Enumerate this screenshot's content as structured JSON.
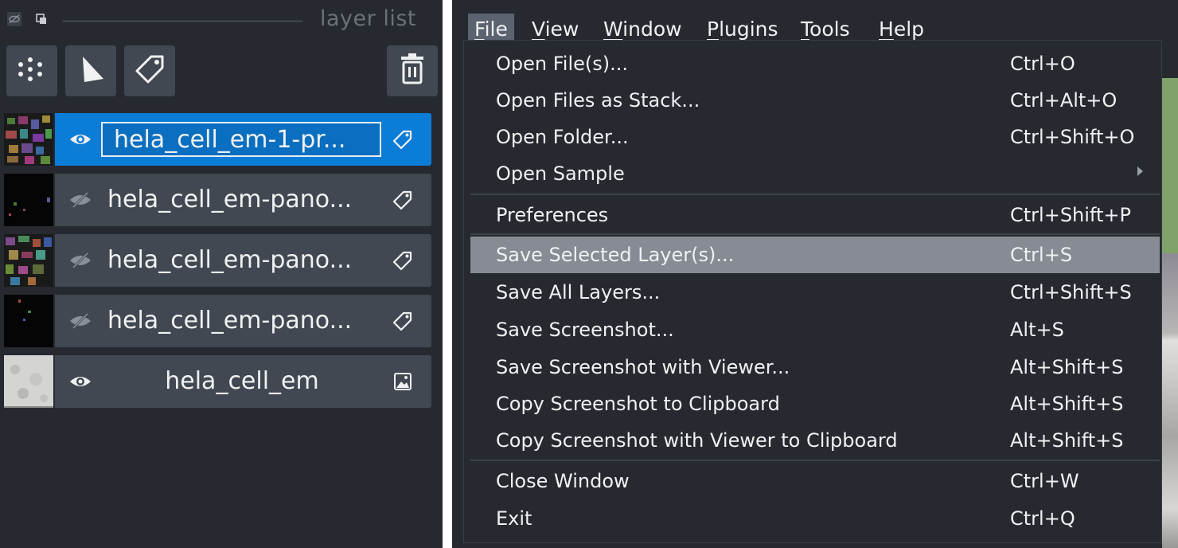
{
  "layer_panel": {
    "title": "layer list",
    "header_buttons": [
      "toggle-visibility-icon",
      "new-window-icon"
    ],
    "tools": [
      {
        "name": "new-points-layer",
        "icon": "points-icon"
      },
      {
        "name": "new-shapes-layer",
        "icon": "shapes-icon"
      },
      {
        "name": "new-labels-layer",
        "icon": "labels-tag-icon"
      },
      {
        "name": "delete-layer",
        "icon": "trash-icon"
      }
    ],
    "layers": [
      {
        "name": "hela_cell_em-1-pr...",
        "visible": true,
        "selected": true,
        "editing": true,
        "type": "labels"
      },
      {
        "name": "hela_cell_em-pano...",
        "visible": false,
        "selected": false,
        "editing": false,
        "type": "labels"
      },
      {
        "name": "hela_cell_em-pano...",
        "visible": false,
        "selected": false,
        "editing": false,
        "type": "labels"
      },
      {
        "name": "hela_cell_em-pano...",
        "visible": false,
        "selected": false,
        "editing": false,
        "type": "labels"
      },
      {
        "name": "hela_cell_em",
        "visible": true,
        "selected": false,
        "editing": false,
        "type": "image"
      }
    ]
  },
  "menubar": {
    "menus": [
      {
        "label": "File",
        "mnemonic": "F",
        "rest": "ile",
        "active": true
      },
      {
        "label": "View",
        "mnemonic": "V",
        "rest": "iew",
        "active": false
      },
      {
        "label": "Window",
        "mnemonic": "W",
        "rest": "indow",
        "active": false
      },
      {
        "label": "Plugins",
        "mnemonic": "P",
        "rest": "lugins",
        "active": false
      },
      {
        "label": "Tools",
        "mnemonic": "T",
        "rest": "ools",
        "active": false
      },
      {
        "label": "Help",
        "mnemonic": "H",
        "rest": "elp",
        "active": false
      }
    ]
  },
  "file_menu": {
    "groups": [
      [
        {
          "label": "Open File(s)...",
          "shortcut": "Ctrl+O"
        },
        {
          "label": "Open Files as Stack...",
          "shortcut": "Ctrl+Alt+O"
        },
        {
          "label": "Open Folder...",
          "shortcut": "Ctrl+Shift+O"
        },
        {
          "label": "Open Sample",
          "shortcut": "",
          "submenu": true
        }
      ],
      [
        {
          "label": "Preferences",
          "shortcut": "Ctrl+Shift+P"
        }
      ],
      [
        {
          "label": "Save Selected Layer(s)...",
          "shortcut": "Ctrl+S",
          "highlighted": true
        },
        {
          "label": "Save All Layers...",
          "shortcut": "Ctrl+Shift+S"
        },
        {
          "label": "Save Screenshot...",
          "shortcut": "Alt+S"
        },
        {
          "label": "Save Screenshot with Viewer...",
          "shortcut": "Alt+Shift+S"
        },
        {
          "label": "Copy Screenshot to Clipboard",
          "shortcut": "Alt+Shift+S"
        },
        {
          "label": "Copy Screenshot with Viewer to Clipboard",
          "shortcut": "Alt+Shift+S"
        }
      ],
      [
        {
          "label": "Close Window",
          "shortcut": "Ctrl+W"
        },
        {
          "label": "Exit",
          "shortcut": "Ctrl+Q"
        }
      ]
    ]
  },
  "colors": {
    "panel_bg": "#262930",
    "row_bg": "#414851",
    "selected_bg": "#0b7dd6",
    "menu_highlight": "#868b94",
    "text": "#f0f1f2"
  }
}
